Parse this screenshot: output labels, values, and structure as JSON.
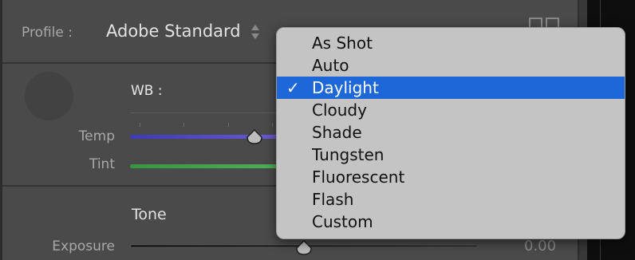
{
  "profile": {
    "label": "Profile :",
    "value": "Adobe Standard",
    "stepper_icon": "up-down-arrows-icon",
    "browse_icon": "profile-grid-icon"
  },
  "white_balance": {
    "label": "WB :",
    "dropper_icon": "wb-eyedropper-icon"
  },
  "sliders": {
    "temp": {
      "label": "Temp",
      "color": "#5a4fc8"
    },
    "tint": {
      "label": "Tint",
      "color": "#3fa34a"
    },
    "exposure": {
      "label": "Exposure",
      "value": "0.00",
      "color": "#2c2c2c"
    }
  },
  "tone": {
    "label": "Tone"
  },
  "wb_menu": {
    "selected_index": 2,
    "check_glyph": "✓",
    "items": [
      {
        "label": "As Shot"
      },
      {
        "label": "Auto"
      },
      {
        "label": "Daylight"
      },
      {
        "label": "Cloudy"
      },
      {
        "label": "Shade"
      },
      {
        "label": "Tungsten"
      },
      {
        "label": "Fluorescent"
      },
      {
        "label": "Flash"
      },
      {
        "label": "Custom"
      }
    ],
    "highlight_color": "#1e67d8"
  }
}
